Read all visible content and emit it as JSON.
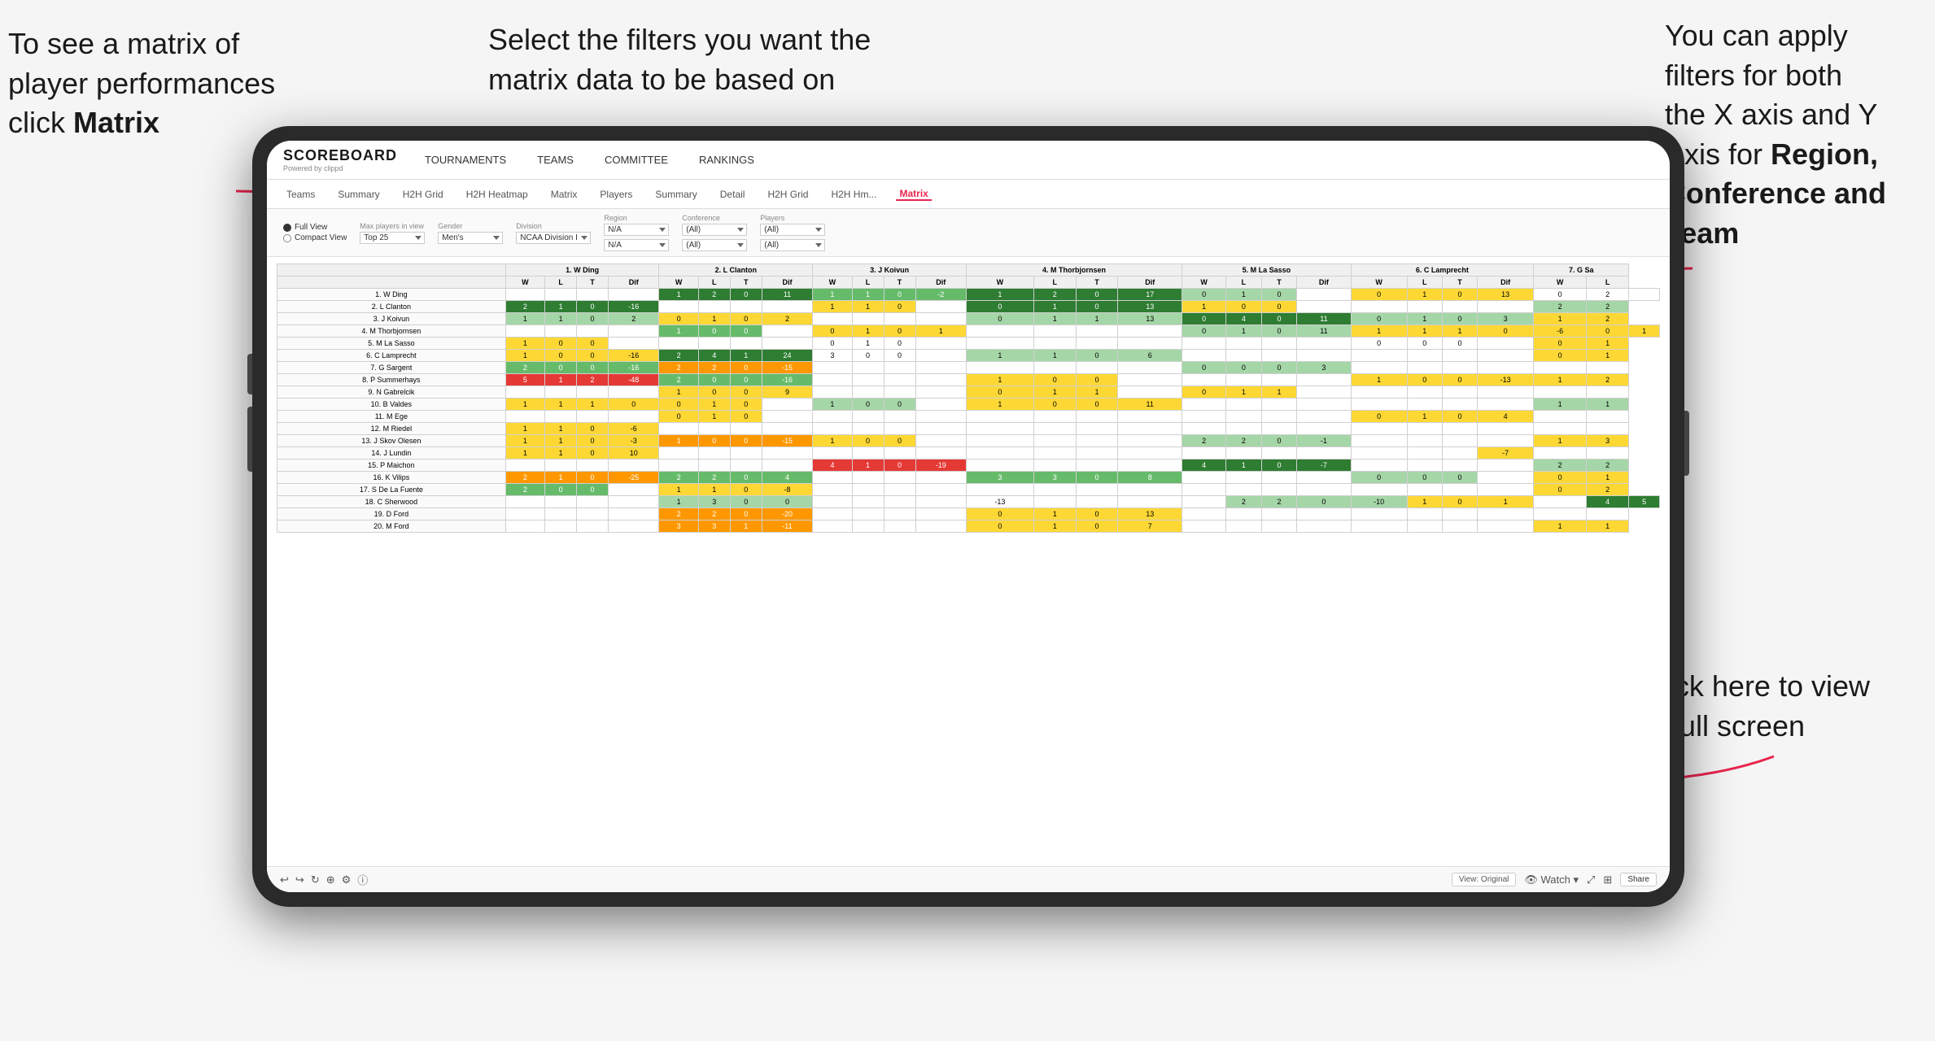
{
  "annotations": {
    "top_left": {
      "line1": "To see a matrix of",
      "line2": "player performances",
      "line3_prefix": "click ",
      "line3_bold": "Matrix"
    },
    "top_center": {
      "line1": "Select the filters you want the",
      "line2": "matrix data to be based on"
    },
    "top_right": {
      "line1": "You  can apply",
      "line2": "filters for both",
      "line3": "the X axis and Y",
      "line4_prefix": "Axis for ",
      "line4_bold": "Region,",
      "line5_bold": "Conference and",
      "line6_bold": "Team"
    },
    "bottom_right": {
      "line1": "Click here to view",
      "line2": "in full screen"
    }
  },
  "app": {
    "logo": "SCOREBOARD",
    "powered_by": "Powered by clippd",
    "nav_items": [
      "TOURNAMENTS",
      "TEAMS",
      "COMMITTEE",
      "RANKINGS"
    ],
    "sub_nav": [
      "Teams",
      "Summary",
      "H2H Grid",
      "H2H Heatmap",
      "Matrix",
      "Players",
      "Summary",
      "Detail",
      "H2H Grid",
      "H2H Hm...",
      "Matrix"
    ],
    "active_tab": "Matrix"
  },
  "filters": {
    "view_full": "Full View",
    "view_compact": "Compact View",
    "max_players_label": "Max players in view",
    "max_players_value": "Top 25",
    "gender_label": "Gender",
    "gender_value": "Men's",
    "division_label": "Division",
    "division_value": "NCAA Division I",
    "region_label": "Region",
    "region_value": "N/A",
    "region_value2": "N/A",
    "conference_label": "Conference",
    "conference_value": "(All)",
    "conference_value2": "(All)",
    "players_label": "Players",
    "players_value": "(All)",
    "players_value2": "(All)"
  },
  "matrix": {
    "col_headers": [
      "1. W Ding",
      "2. L Clanton",
      "3. J Koivun",
      "4. M Thorbjornsen",
      "5. M La Sasso",
      "6. C Lamprecht",
      "7. G Sa"
    ],
    "col_subheaders": [
      "W",
      "L",
      "T",
      "Dif"
    ],
    "rows": [
      {
        "name": "1. W Ding",
        "cells": [
          [
            "",
            "",
            "",
            ""
          ],
          [
            "1",
            "2",
            "0",
            "11"
          ],
          [
            "1",
            "1",
            "0",
            "-2"
          ],
          [
            "1",
            "2",
            "0",
            "17"
          ],
          [
            "0",
            "1",
            "0",
            ""
          ],
          [
            "0",
            "1",
            "0",
            "13"
          ],
          [
            "0",
            "2",
            ""
          ]
        ]
      },
      {
        "name": "2. L Clanton",
        "cells": [
          [
            "2",
            "1",
            "0",
            "-16"
          ],
          [
            "",
            "",
            "",
            ""
          ],
          [
            "1",
            "1",
            "0",
            ""
          ],
          [
            "0",
            "1",
            "0",
            "13"
          ],
          [
            "1",
            "0",
            "0",
            ""
          ],
          [
            "",
            "",
            "",
            ""
          ],
          [
            "2",
            "2"
          ]
        ]
      },
      {
        "name": "3. J Koivun",
        "cells": [
          [
            "1",
            "1",
            "0",
            "2"
          ],
          [
            "0",
            "1",
            "0",
            "2"
          ],
          [
            "",
            "",
            "",
            ""
          ],
          [
            "0",
            "1",
            "1",
            "13"
          ],
          [
            "0",
            "4",
            "0",
            "11"
          ],
          [
            "0",
            "1",
            "0",
            "3"
          ],
          [
            "1",
            "2"
          ]
        ]
      },
      {
        "name": "4. M Thorbjornsen",
        "cells": [
          [
            "",
            "",
            "",
            ""
          ],
          [
            "1",
            "0",
            "0",
            ""
          ],
          [
            "0",
            "1",
            "0",
            "1"
          ],
          [
            "",
            "",
            "",
            ""
          ],
          [
            "0",
            "1",
            "0",
            "11"
          ],
          [
            "1",
            "1",
            "1",
            "0",
            "-6"
          ],
          [
            "0",
            "1"
          ]
        ]
      },
      {
        "name": "5. M La Sasso",
        "cells": [
          [
            "1",
            "0",
            "0",
            ""
          ],
          [
            "",
            "",
            "",
            ""
          ],
          [
            "0",
            "1",
            "0",
            ""
          ],
          [
            "",
            "",
            "",
            ""
          ],
          [
            "",
            "",
            "",
            ""
          ],
          [
            "0",
            "0",
            "0",
            ""
          ],
          [
            "0",
            "1"
          ]
        ]
      },
      {
        "name": "6. C Lamprecht",
        "cells": [
          [
            "1",
            "0",
            "0",
            "-16"
          ],
          [
            "2",
            "4",
            "1",
            "24"
          ],
          [
            "3",
            "0",
            "0",
            ""
          ],
          [
            "1",
            "1",
            "0",
            "6"
          ],
          [
            "",
            "",
            "",
            ""
          ],
          [
            "",
            "",
            "",
            ""
          ],
          [
            "0",
            "1"
          ]
        ]
      },
      {
        "name": "7. G Sargent",
        "cells": [
          [
            "2",
            "0",
            "0",
            "-16"
          ],
          [
            "2",
            "2",
            "0",
            "-15"
          ],
          [
            "",
            "",
            "",
            ""
          ],
          [
            "",
            "",
            "",
            ""
          ],
          [
            "0",
            "0",
            "0",
            "3"
          ],
          [
            "",
            "",
            "",
            ""
          ],
          [
            "",
            ""
          ]
        ]
      },
      {
        "name": "8. P Summerhays",
        "cells": [
          [
            "5",
            "1",
            "2",
            "-48"
          ],
          [
            "2",
            "0",
            "0",
            "-16"
          ],
          [
            "",
            "",
            "",
            ""
          ],
          [
            "1",
            "0",
            "0",
            ""
          ],
          [
            "",
            "",
            "",
            ""
          ],
          [
            "1",
            "0",
            "0",
            "-13"
          ],
          [
            "1",
            "2"
          ]
        ]
      },
      {
        "name": "9. N Gabrelcik",
        "cells": [
          [
            "",
            "",
            "",
            ""
          ],
          [
            "1",
            "0",
            "0",
            "9"
          ],
          [
            "",
            "",
            "",
            ""
          ],
          [
            "0",
            "1",
            "1",
            ""
          ],
          [
            "0",
            "1",
            "1",
            ""
          ],
          [
            "",
            "",
            "",
            ""
          ],
          [
            "",
            ""
          ]
        ]
      },
      {
        "name": "10. B Valdes",
        "cells": [
          [
            "1",
            "1",
            "1",
            "0"
          ],
          [
            "0",
            "1",
            "0",
            ""
          ],
          [
            "1",
            "0",
            "0",
            ""
          ],
          [
            "1",
            "0",
            "0",
            "11"
          ],
          [
            "",
            "",
            "",
            ""
          ],
          [
            "",
            "",
            "",
            ""
          ],
          [
            "1",
            "1"
          ]
        ]
      },
      {
        "name": "11. M Ege",
        "cells": [
          [
            "",
            "",
            "",
            ""
          ],
          [
            "0",
            "1",
            "0",
            ""
          ],
          [
            "",
            "",
            "",
            ""
          ],
          [
            "",
            "",
            "",
            ""
          ],
          [
            "",
            "",
            "",
            ""
          ],
          [
            "0",
            "1",
            "0",
            "4"
          ],
          [
            "",
            ""
          ]
        ]
      },
      {
        "name": "12. M Riedel",
        "cells": [
          [
            "1",
            "1",
            "0",
            "-6"
          ],
          [
            "",
            "",
            "",
            ""
          ],
          [
            "",
            "",
            "",
            ""
          ],
          [
            "",
            "",
            "",
            ""
          ],
          [
            "",
            "",
            "",
            ""
          ],
          [
            "",
            "",
            "",
            ""
          ],
          [
            "",
            ""
          ]
        ]
      },
      {
        "name": "13. J Skov Olesen",
        "cells": [
          [
            "1",
            "1",
            "0",
            "-3"
          ],
          [
            "1",
            "0",
            "0",
            "-15"
          ],
          [
            "1",
            "0",
            "0",
            ""
          ],
          [
            "",
            "",
            "",
            ""
          ],
          [
            "2",
            "2",
            "0",
            "-1"
          ],
          [
            "",
            "",
            "",
            ""
          ],
          [
            "1",
            "3"
          ]
        ]
      },
      {
        "name": "14. J Lundin",
        "cells": [
          [
            "1",
            "1",
            "0",
            "10"
          ],
          [
            "",
            "",
            "",
            ""
          ],
          [
            "",
            "",
            "",
            ""
          ],
          [
            "",
            "",
            "",
            ""
          ],
          [
            "",
            "",
            "",
            ""
          ],
          [
            "",
            "",
            "",
            "-7"
          ],
          [
            "",
            ""
          ]
        ]
      },
      {
        "name": "15. P Maichon",
        "cells": [
          [
            "",
            "",
            "",
            ""
          ],
          [
            "",
            "",
            "",
            ""
          ],
          [
            "4",
            "1",
            "0",
            "-19"
          ],
          [
            "",
            "",
            "",
            ""
          ],
          [
            "4",
            "1",
            "0",
            "-7"
          ],
          [
            "",
            "",
            "",
            ""
          ],
          [
            "2",
            "2"
          ]
        ]
      },
      {
        "name": "16. K Vilips",
        "cells": [
          [
            "2",
            "1",
            "0",
            "-25"
          ],
          [
            "2",
            "2",
            "0",
            "4"
          ],
          [
            "",
            "",
            "",
            ""
          ],
          [
            "3",
            "3",
            "0",
            "8"
          ],
          [
            "",
            "",
            "",
            ""
          ],
          [
            "0",
            "0",
            "0",
            ""
          ],
          [
            "0",
            "1"
          ]
        ]
      },
      {
        "name": "17. S De La Fuente",
        "cells": [
          [
            "2",
            "0",
            "0",
            ""
          ],
          [
            "1",
            "1",
            "0",
            "-8"
          ],
          [
            "",
            "",
            "",
            ""
          ],
          [
            "",
            "",
            "",
            ""
          ],
          [
            "",
            "",
            "",
            ""
          ],
          [
            "",
            "",
            "",
            ""
          ],
          [
            "0",
            "2"
          ]
        ]
      },
      {
        "name": "18. C Sherwood",
        "cells": [
          [
            "",
            "",
            "",
            ""
          ],
          [
            "1",
            "3",
            "0",
            "0"
          ],
          [
            "",
            "",
            "",
            "",
            "-13"
          ],
          [
            "",
            "",
            "",
            ""
          ],
          [
            "2",
            "2",
            "0",
            "-10"
          ],
          [
            "1",
            "0",
            "1",
            ""
          ],
          [
            "4",
            "5"
          ]
        ]
      },
      {
        "name": "19. D Ford",
        "cells": [
          [
            "",
            "",
            "",
            ""
          ],
          [
            "2",
            "2",
            "0",
            "-20"
          ],
          [
            "",
            "",
            "",
            ""
          ],
          [
            "0",
            "1",
            "0",
            "13"
          ],
          [
            "",
            "",
            "",
            ""
          ],
          [
            "",
            "",
            "",
            ""
          ],
          [
            "",
            ""
          ]
        ]
      },
      {
        "name": "20. M Ford",
        "cells": [
          [
            "",
            "",
            "",
            ""
          ],
          [
            "3",
            "3",
            "1",
            "-11"
          ],
          [
            "",
            "",
            "",
            ""
          ],
          [
            "0",
            "1",
            "0",
            "7"
          ],
          [
            "",
            "",
            "",
            ""
          ],
          [
            "",
            "",
            "",
            ""
          ],
          [
            "1",
            "1"
          ]
        ]
      }
    ]
  },
  "toolbar": {
    "view_original": "View: Original",
    "watch": "Watch",
    "share": "Share"
  }
}
